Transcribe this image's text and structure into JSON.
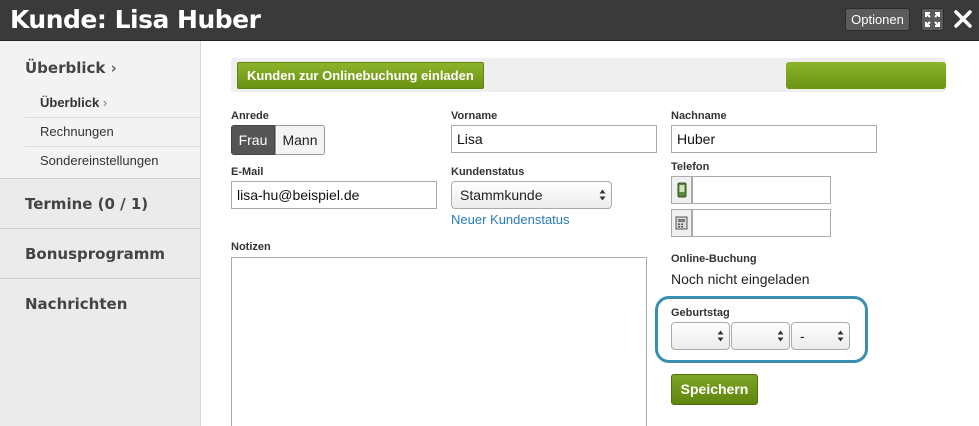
{
  "header": {
    "title": "Kunde: Lisa Huber",
    "options_label": "Optionen",
    "expand_icon": "expand-icon",
    "close_icon": "close-icon"
  },
  "sidebar": {
    "overview_header": "Überblick",
    "sub_items": [
      {
        "label": "Überblick",
        "active": true
      },
      {
        "label": "Rechnungen",
        "active": false
      },
      {
        "label": "Sondereinstellungen",
        "active": false
      }
    ],
    "sections": [
      {
        "label": "Termine (0 / 1)"
      },
      {
        "label": "Bonusprogramm"
      },
      {
        "label": "Nachrichten"
      }
    ]
  },
  "toolbar": {
    "invite_label": "Kunden zur Onlinebuchung einladen"
  },
  "form": {
    "salutation": {
      "label": "Anrede",
      "options": [
        "Frau",
        "Mann"
      ],
      "selected": "Frau"
    },
    "first_name": {
      "label": "Vorname",
      "value": "Lisa"
    },
    "last_name": {
      "label": "Nachname",
      "value": "Huber"
    },
    "email": {
      "label": "E-Mail",
      "value": "lisa-hu@beispiel.de"
    },
    "customer_status": {
      "label": "Kundenstatus",
      "value": "Stammkunde",
      "new_link": "Neuer Kundenstatus"
    },
    "phone": {
      "label": "Telefon",
      "mobile_icon": "mobile-phone-icon",
      "landline_icon": "landline-phone-icon",
      "mobile_value": "",
      "landline_value": ""
    },
    "notes": {
      "label": "Notizen",
      "value": ""
    },
    "online_booking": {
      "label": "Online-Buchung",
      "value": "Noch nicht eingeladen"
    },
    "birthday": {
      "label": "Geburtstag",
      "day": "",
      "month": "",
      "year": "-"
    },
    "save_label": "Speichern"
  },
  "colors": {
    "accent_green": "#7ea524",
    "highlight_blue": "#3b8fae",
    "link_blue": "#2a7ab8",
    "titlebar": "#3a3a3a"
  }
}
